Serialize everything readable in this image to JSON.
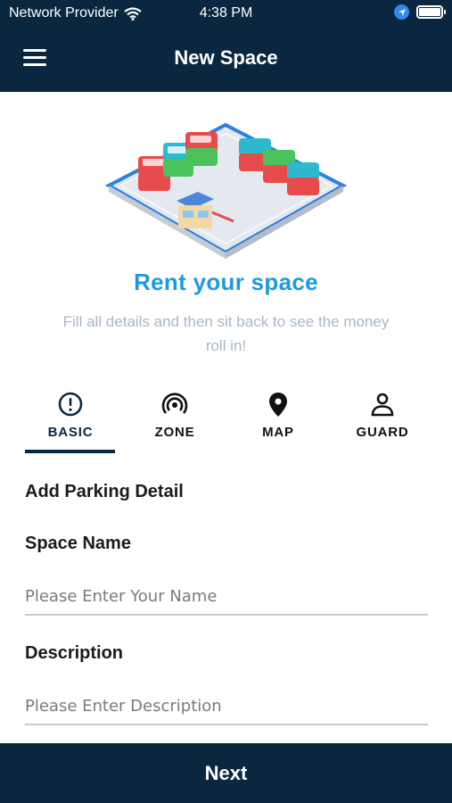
{
  "status_bar": {
    "carrier": "Network Provider",
    "time": "4:38 PM"
  },
  "header": {
    "title": "New Space",
    "menu_icon": "hamburger-menu-icon"
  },
  "hero": {
    "image": "parking-lot-illustration",
    "title": "Rent your space",
    "subtitle": "Fill all details and then sit back to see the money roll in!"
  },
  "tabs": [
    {
      "label": "BASIC",
      "icon": "info-icon",
      "active": true
    },
    {
      "label": "ZONE",
      "icon": "signal-icon",
      "active": false
    },
    {
      "label": "MAP",
      "icon": "map-pin-icon",
      "active": false
    },
    {
      "label": "GUARD",
      "icon": "user-icon",
      "active": false
    }
  ],
  "form": {
    "section_title": "Add Parking Detail",
    "space_name_label": "Space Name",
    "space_name_placeholder": "Please Enter Your Name",
    "description_label": "Description",
    "description_placeholder": "Please Enter Description"
  },
  "footer": {
    "next_label": "Next"
  },
  "colors": {
    "primary": "#0b2740",
    "accent": "#1e9bdc",
    "muted": "#a9b7c6"
  }
}
